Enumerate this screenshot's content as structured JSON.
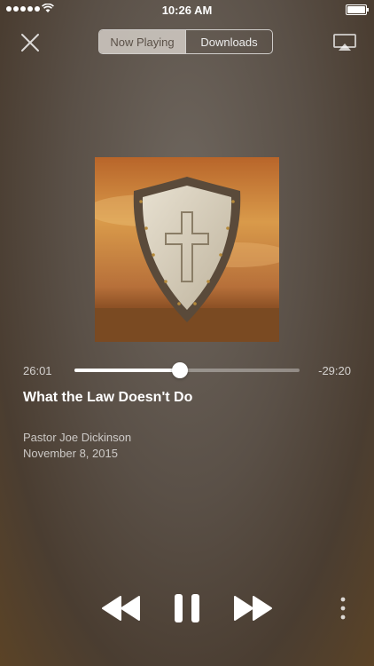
{
  "status_bar": {
    "time": "10:26 AM",
    "signal_dots": 5,
    "battery_level": 1.0
  },
  "header": {
    "close_icon": "close-icon",
    "tabs": [
      {
        "label": "Now Playing",
        "active": true
      },
      {
        "label": "Downloads",
        "active": false
      }
    ],
    "airplay_icon": "airplay-icon"
  },
  "artwork": {
    "icon": "shield-cross-icon"
  },
  "progress": {
    "elapsed": "26:01",
    "remaining": "-29:20",
    "fraction": 0.47
  },
  "track": {
    "title": "What the Law Doesn't Do",
    "speaker": "Pastor Joe Dickinson",
    "date": "November 8, 2015"
  },
  "controls": {
    "rewind_icon": "rewind-icon",
    "pause_icon": "pause-icon",
    "forward_icon": "fast-forward-icon",
    "more_icon": "more-vertical-icon"
  },
  "colors": {
    "background": "#5a5047",
    "accent": "#ffffff"
  }
}
